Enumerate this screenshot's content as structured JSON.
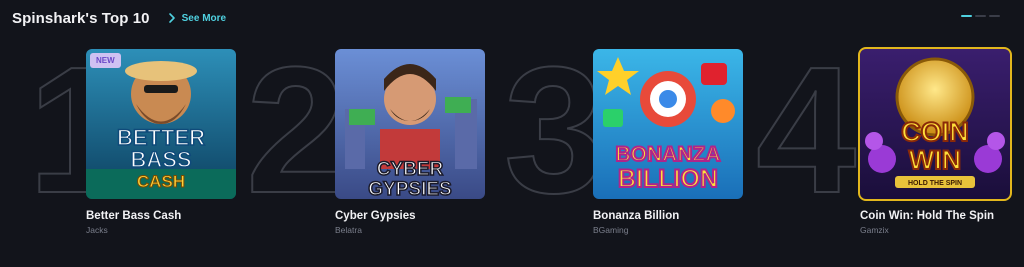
{
  "section": {
    "title": "Spinshark's Top 10",
    "see_more_label": "See More"
  },
  "pager": {
    "pages": 3,
    "active": 1
  },
  "games": [
    {
      "rank": "1",
      "name": "Better Bass Cash",
      "provider": "Jacks",
      "badge": "NEW",
      "art_line1": "BETTER",
      "art_line2": "BASS",
      "art_line3": "CASH"
    },
    {
      "rank": "2",
      "name": "Cyber Gypsies",
      "provider": "Belatra",
      "art_line1": "CYBER",
      "art_line2": "GYPSIES"
    },
    {
      "rank": "3",
      "name": "Bonanza Billion",
      "provider": "BGaming",
      "art_line1": "BONANZA",
      "art_line2": "BILLION"
    },
    {
      "rank": "4",
      "name": "Coin Win: Hold The Spin",
      "provider": "Gamzix",
      "art_line1": "COIN",
      "art_line2": "WIN",
      "art_line3": "HOLD THE SPIN"
    }
  ],
  "colors": {
    "accent": "#4fd1e0",
    "background": "#12141b",
    "selected_outline": "#e2b71d"
  }
}
